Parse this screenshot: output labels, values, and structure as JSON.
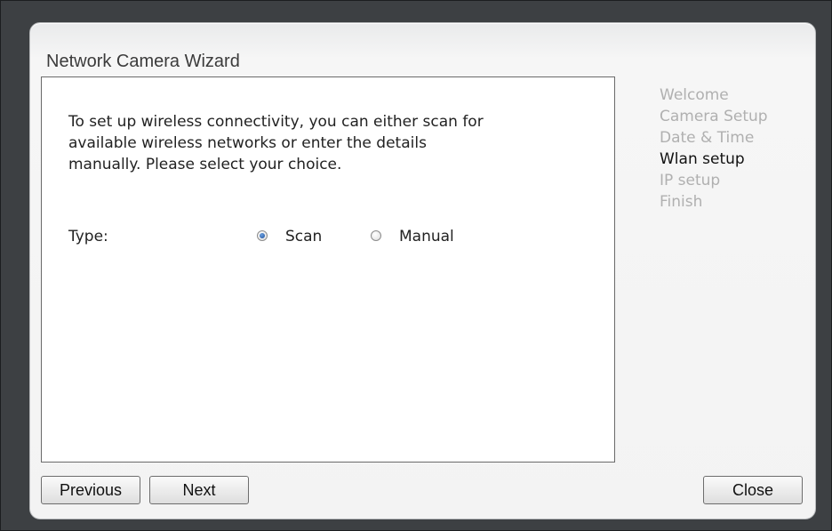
{
  "wizard": {
    "title": "Network Camera Wizard"
  },
  "content": {
    "description": "To set up wireless connectivity, you can either scan for available wireless networks or enter the details manually. Please select your choice.",
    "type_label": "Type:",
    "options": [
      {
        "label": "Scan",
        "selected": true
      },
      {
        "label": "Manual",
        "selected": false
      }
    ]
  },
  "steps": [
    {
      "label": "Welcome",
      "active": false
    },
    {
      "label": "Camera Setup",
      "active": false
    },
    {
      "label": "Date & Time",
      "active": false
    },
    {
      "label": "Wlan setup",
      "active": true
    },
    {
      "label": "IP setup",
      "active": false
    },
    {
      "label": "Finish",
      "active": false
    }
  ],
  "buttons": {
    "previous": "Previous",
    "next": "Next",
    "close": "Close"
  }
}
